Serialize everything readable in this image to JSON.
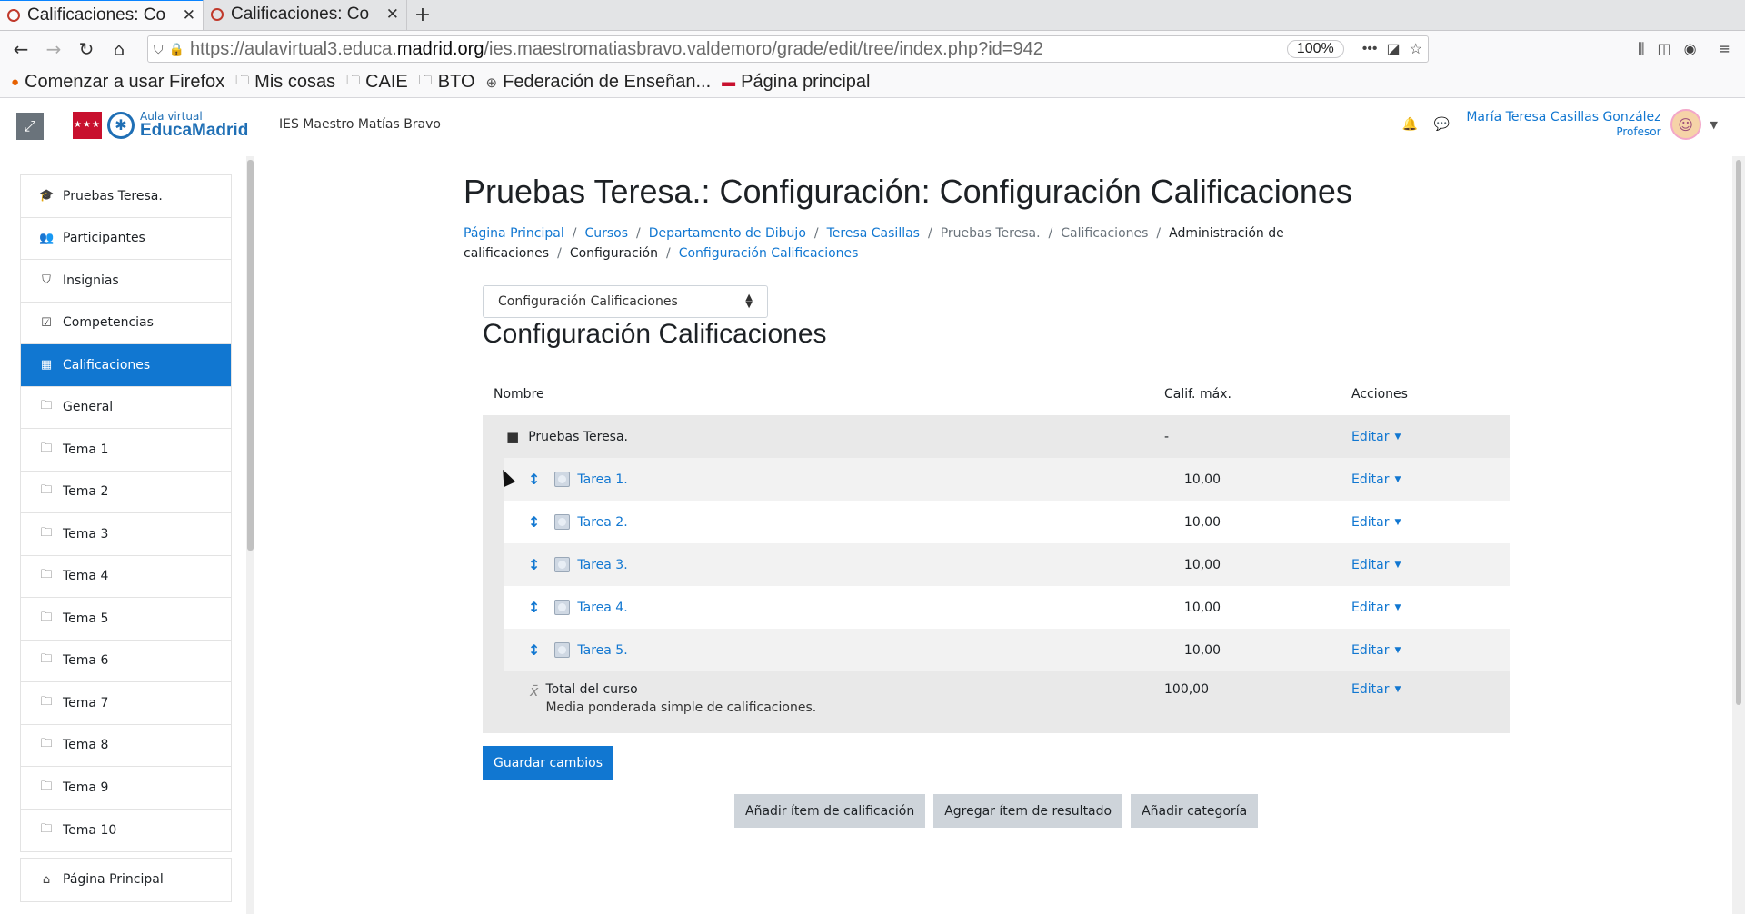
{
  "browser": {
    "tabs": [
      {
        "title": "Calificaciones: Co",
        "active": true
      },
      {
        "title": "Calificaciones: Co",
        "active": false
      }
    ],
    "url_prefix": "https://aulavirtual3.educa.",
    "url_domain": "madrid.org",
    "url_path": "/ies.maestromatiasbravo.valdemoro/grade/edit/tree/index.php?id=942",
    "zoom": "100%",
    "bookmarks": [
      {
        "label": "Comenzar a usar Firefox",
        "icon": "firefox-icon"
      },
      {
        "label": "Mis cosas",
        "icon": "folder-icon"
      },
      {
        "label": "CAIE",
        "icon": "folder-icon"
      },
      {
        "label": "BTO",
        "icon": "folder-icon"
      },
      {
        "label": "Federación de Enseñan...",
        "icon": "globe-icon"
      },
      {
        "label": "Página principal",
        "icon": "madrid-icon"
      }
    ]
  },
  "header": {
    "logo_small": "Aula virtual",
    "logo_big": "EducaMadrid",
    "school": "IES Maestro Matías Bravo",
    "user_name": "María Teresa Casillas González",
    "user_role": "Profesor"
  },
  "sidebar": {
    "items": [
      {
        "label": "Pruebas Teresa.",
        "icon": "graduation-cap-icon",
        "glyph": "🎓"
      },
      {
        "label": "Participantes",
        "icon": "users-icon",
        "glyph": "👥"
      },
      {
        "label": "Insignias",
        "icon": "shield-icon",
        "glyph": "⛉"
      },
      {
        "label": "Competencias",
        "icon": "check-square-icon",
        "glyph": "☑"
      },
      {
        "label": "Calificaciones",
        "icon": "table-icon",
        "glyph": "▦",
        "active": true
      },
      {
        "label": "General",
        "icon": "folder-icon",
        "glyph": "🗀"
      },
      {
        "label": "Tema 1",
        "icon": "folder-icon",
        "glyph": "🗀"
      },
      {
        "label": "Tema 2",
        "icon": "folder-icon",
        "glyph": "🗀"
      },
      {
        "label": "Tema 3",
        "icon": "folder-icon",
        "glyph": "🗀"
      },
      {
        "label": "Tema 4",
        "icon": "folder-icon",
        "glyph": "🗀"
      },
      {
        "label": "Tema 5",
        "icon": "folder-icon",
        "glyph": "🗀"
      },
      {
        "label": "Tema 6",
        "icon": "folder-icon",
        "glyph": "🗀"
      },
      {
        "label": "Tema 7",
        "icon": "folder-icon",
        "glyph": "🗀"
      },
      {
        "label": "Tema 8",
        "icon": "folder-icon",
        "glyph": "🗀"
      },
      {
        "label": "Tema 9",
        "icon": "folder-icon",
        "glyph": "🗀"
      },
      {
        "label": "Tema 10",
        "icon": "folder-icon",
        "glyph": "🗀"
      }
    ],
    "bottom": [
      {
        "label": "Página Principal",
        "icon": "home-icon",
        "glyph": "⌂"
      }
    ]
  },
  "page": {
    "title": "Pruebas Teresa.: Configuración: Configuración Calificaciones",
    "breadcrumb": [
      {
        "label": "Página Principal",
        "style": "link"
      },
      {
        "label": "Cursos",
        "style": "link"
      },
      {
        "label": "Departamento de Dibujo",
        "style": "link"
      },
      {
        "label": "Teresa Casillas",
        "style": "link"
      },
      {
        "label": "Pruebas Teresa.",
        "style": "muted"
      },
      {
        "label": "Calificaciones",
        "style": "muted"
      },
      {
        "label": "Administración de calificaciones",
        "style": "plain"
      },
      {
        "label": "Configuración",
        "style": "plain"
      },
      {
        "label": "Configuración Calificaciones",
        "style": "link"
      }
    ],
    "select_value": "Configuración Calificaciones",
    "section_title": "Configuración Calificaciones"
  },
  "table": {
    "headers": {
      "name": "Nombre",
      "max": "Calif. máx.",
      "actions": "Acciones"
    },
    "category": {
      "name": "Pruebas Teresa.",
      "max": "-",
      "action": "Editar"
    },
    "items": [
      {
        "name": "Tarea 1.",
        "max": "10,00",
        "action": "Editar"
      },
      {
        "name": "Tarea 2.",
        "max": "10,00",
        "action": "Editar"
      },
      {
        "name": "Tarea 3.",
        "max": "10,00",
        "action": "Editar"
      },
      {
        "name": "Tarea 4.",
        "max": "10,00",
        "action": "Editar"
      },
      {
        "name": "Tarea 5.",
        "max": "10,00",
        "action": "Editar"
      }
    ],
    "total": {
      "name": "Total del curso",
      "desc": "Media ponderada simple de calificaciones.",
      "max": "100,00",
      "action": "Editar"
    }
  },
  "buttons": {
    "save": "Guardar cambios",
    "add_item": "Añadir ítem de calificación",
    "add_outcome": "Agregar ítem de resultado",
    "add_category": "Añadir categoría"
  },
  "colors": {
    "accent": "#1177d1",
    "brand_red": "#c8102e"
  }
}
